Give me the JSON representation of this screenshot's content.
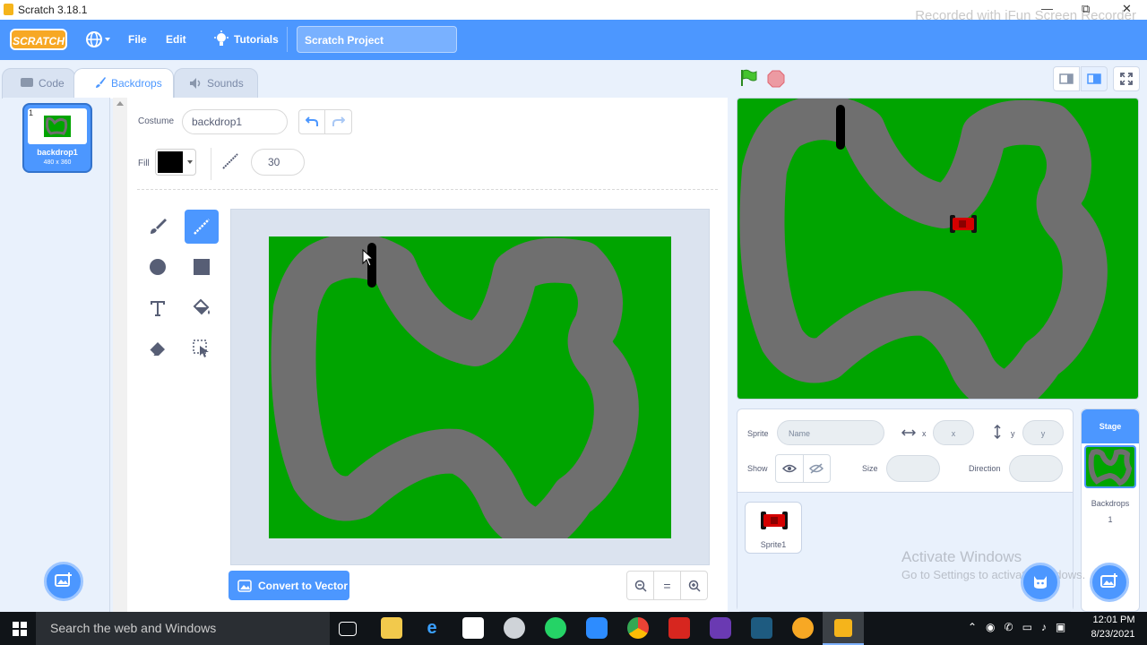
{
  "window": {
    "title": "Scratch 3.18.1",
    "watermark": "Recorded with iFun Screen Recorder",
    "controls": {
      "minimize": "—",
      "restore": "⧉",
      "close": "✕"
    }
  },
  "menubar": {
    "logo": "SCRATCH",
    "file": "File",
    "edit": "Edit",
    "tutorials": "Tutorials",
    "project_name": "Scratch Project"
  },
  "tabs": {
    "code": "Code",
    "backdrops": "Backdrops",
    "sounds": "Sounds"
  },
  "costume_list": {
    "items": [
      {
        "number": "1",
        "name": "backdrop1",
        "size": "480 x 360"
      }
    ]
  },
  "editor": {
    "costume_label": "Costume",
    "costume_name": "backdrop1",
    "fill_label": "Fill",
    "fill_color": "#000000",
    "line_width": "30",
    "convert_button": "Convert to Vector",
    "zoom_reset": "="
  },
  "sprite_panel": {
    "sprite_label": "Sprite",
    "name_placeholder": "Name",
    "x_label": "x",
    "x_placeholder": "x",
    "y_label": "y",
    "y_placeholder": "y",
    "show_label": "Show",
    "size_label": "Size",
    "direction_label": "Direction",
    "sprites": [
      {
        "name": "Sprite1"
      }
    ]
  },
  "stage_panel": {
    "title": "Stage",
    "backdrops_label": "Backdrops",
    "backdrops_count": "1"
  },
  "activate": {
    "title": "Activate Windows",
    "subtitle": "Go to Settings to activate Windows."
  },
  "taskbar": {
    "search_placeholder": "Search the web and Windows",
    "time": "12:01 PM",
    "date": "8/23/2021"
  },
  "colors": {
    "scratch_blue": "#4c97ff",
    "grass": "#00a400",
    "track": "#6f6f6f",
    "car_red": "#d40000"
  }
}
